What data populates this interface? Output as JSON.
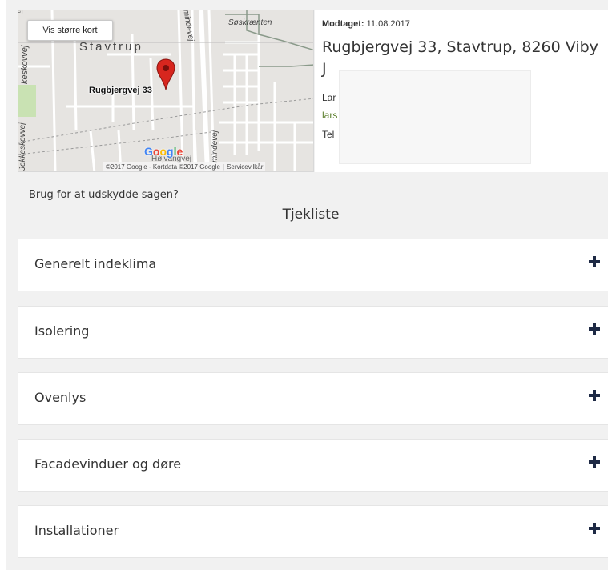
{
  "map": {
    "larger_map_button": "Vis større kort",
    "area_label": "Stavtrup",
    "street_soskraenten": "Søskrænten",
    "street_keskovvej": "keskovvej",
    "street_kokkeskovvej": "Jokkeskovvej",
    "street_mindevej_top": "mindevej",
    "street_mindevej_bottom": "mindevej",
    "street_hojvangvej": "Højvangvej",
    "street_top_left_fragment": "ej",
    "marker_label": "Rugbjergvej 33",
    "google_logo": "Google",
    "footer_copyright": "©2017 Google - Kortdata ©2017 Google",
    "footer_terms": "Servicevilkår",
    "colors": {
      "background": "#e6e4e1",
      "road": "#ffffff",
      "pin": "#d7261e",
      "park": "#c9e2b3"
    }
  },
  "case_info": {
    "received_label": "Modtaget:",
    "received_date": "11.08.2017",
    "address": "Rugbjergvej 33, Stavtrup, 8260 Viby J",
    "contact_name_fragment": "Lar",
    "contact_email_fragment": "lars",
    "contact_phone_fragment": "Tel"
  },
  "postpone_text": "Brug for at udskydde sagen?",
  "checklist": {
    "title": "Tjekliste",
    "items": [
      {
        "label": "Generelt indeklima",
        "icon": "plus-icon"
      },
      {
        "label": "Isolering",
        "icon": "plus-icon"
      },
      {
        "label": "Ovenlys",
        "icon": "plus-icon"
      },
      {
        "label": "Facadevinduer og døre",
        "icon": "plus-icon"
      },
      {
        "label": "Installationer",
        "icon": "plus-icon"
      }
    ]
  },
  "colors": {
    "page_background": "#f1f1f1",
    "panel_background": "#ffffff",
    "plus_icon": "#1e2a45",
    "email_link": "#5a7d2b"
  }
}
